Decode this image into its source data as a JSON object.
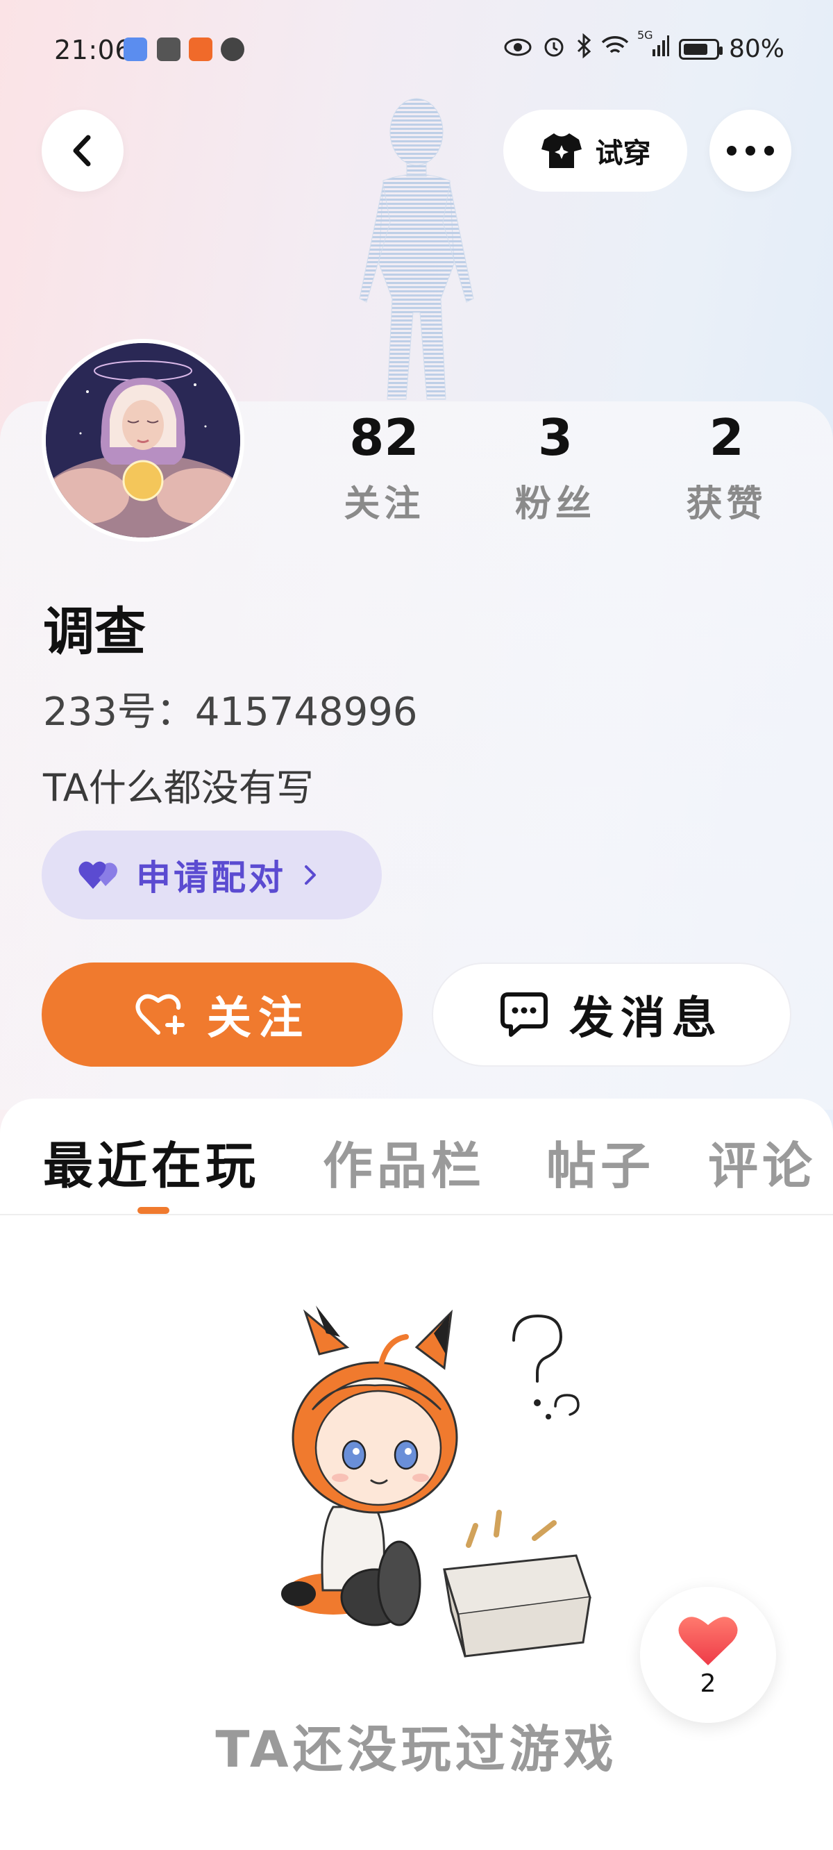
{
  "status_bar": {
    "time": "21:06",
    "network_label": "5G",
    "battery": "80%",
    "battery_level": 0.8
  },
  "header": {
    "back_icon": "chevron-left-icon",
    "try_on_label": "试穿",
    "more_icon": "more-horizontal-icon"
  },
  "profile": {
    "stats": [
      {
        "value": "82",
        "label": "关注"
      },
      {
        "value": "3",
        "label": "粉丝"
      },
      {
        "value": "2",
        "label": "获赞"
      }
    ],
    "name": "调查",
    "uid": "233号：415748996",
    "bio": "TA什么都没有写",
    "pair_button": "申请配对",
    "follow_button": "关注",
    "message_button": "发消息"
  },
  "tabs": [
    {
      "label": "最近在玩",
      "active": true
    },
    {
      "label": "作品栏",
      "active": false
    },
    {
      "label": "帖子",
      "active": false
    },
    {
      "label": "评论",
      "active": false
    }
  ],
  "empty_state": {
    "text": "TA还没玩过游戏"
  },
  "like_fab": {
    "count": "2"
  },
  "colors": {
    "accent": "#f07a2e",
    "pair_bg": "#e3e0f6",
    "pair_text": "#5b4bd1",
    "muted_text": "#9a9a9a"
  }
}
